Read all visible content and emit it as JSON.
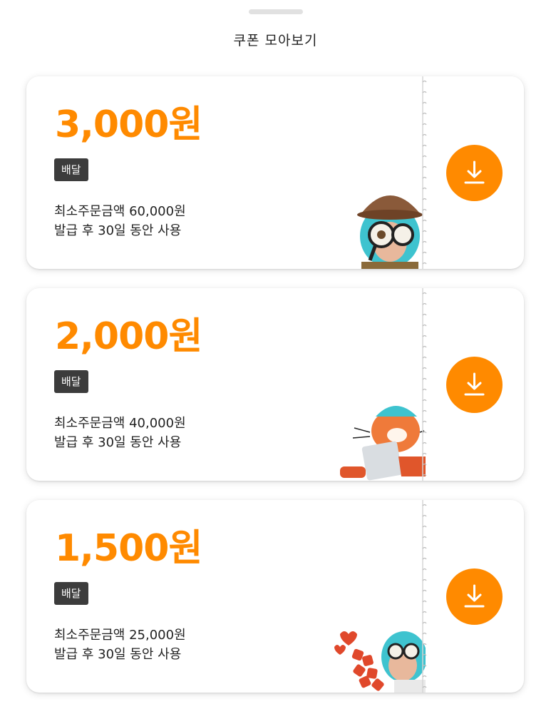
{
  "sheet": {
    "title": "쿠폰 모아보기"
  },
  "coupons": [
    {
      "amount": "3,000원",
      "tag": "배달",
      "min_order": "최소주문금액 60,000원",
      "validity": "발급 후 30일 동안 사용",
      "mascot": "detective-character"
    },
    {
      "amount": "2,000원",
      "tag": "배달",
      "min_order": "최소주문금액 40,000원",
      "validity": "발급 후 30일 동안 사용",
      "mascot": "cat-with-tablet-character"
    },
    {
      "amount": "1,500원",
      "tag": "배달",
      "min_order": "최소주문금액 25,000원",
      "validity": "발급 후 30일 동안 사용",
      "mascot": "character-with-hearts"
    }
  ],
  "colors": {
    "accent": "#ff8a00",
    "badge": "#3c3c3c"
  },
  "icons": {
    "download": "download-icon"
  }
}
